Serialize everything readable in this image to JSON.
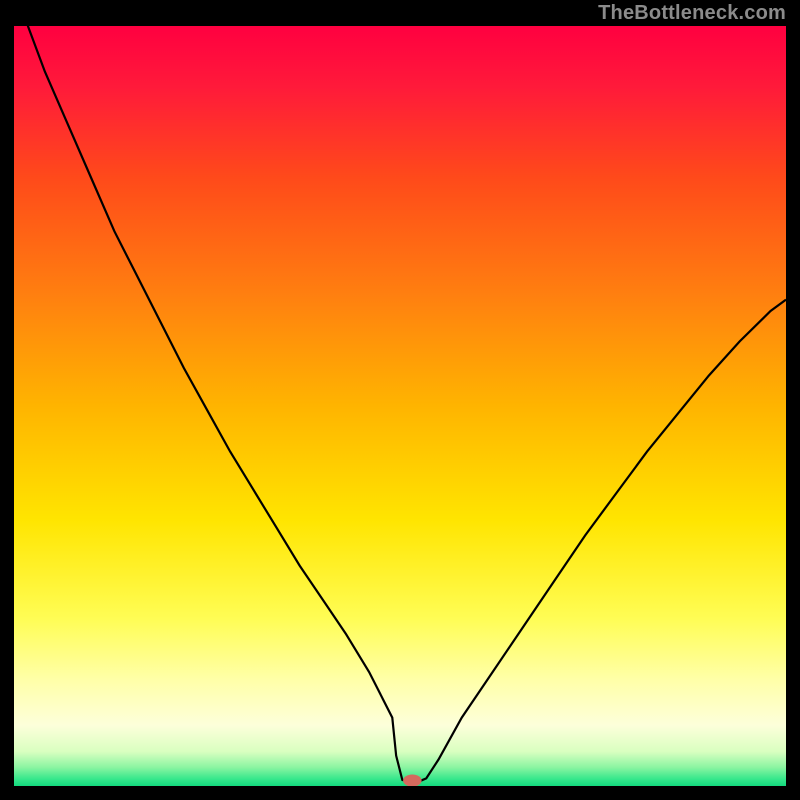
{
  "watermark": "TheBottleneck.com",
  "chart_data": {
    "type": "line",
    "title": "",
    "xlabel": "",
    "ylabel": "",
    "xlim": [
      0,
      100
    ],
    "ylim": [
      0,
      100
    ],
    "gradient_stops": [
      {
        "offset": 0.0,
        "color": "#ff0040"
      },
      {
        "offset": 0.08,
        "color": "#ff1a3a"
      },
      {
        "offset": 0.2,
        "color": "#ff4a1a"
      },
      {
        "offset": 0.35,
        "color": "#ff7e10"
      },
      {
        "offset": 0.5,
        "color": "#ffb400"
      },
      {
        "offset": 0.65,
        "color": "#ffe500"
      },
      {
        "offset": 0.78,
        "color": "#fffd55"
      },
      {
        "offset": 0.86,
        "color": "#ffffa8"
      },
      {
        "offset": 0.92,
        "color": "#fdffda"
      },
      {
        "offset": 0.955,
        "color": "#d9ffc0"
      },
      {
        "offset": 0.975,
        "color": "#8df5a2"
      },
      {
        "offset": 0.99,
        "color": "#3ae88d"
      },
      {
        "offset": 1.0,
        "color": "#14d97e"
      }
    ],
    "series": [
      {
        "name": "bottleneck-curve",
        "x": [
          0,
          1.8,
          4,
          7,
          10,
          13,
          16,
          19,
          22,
          25,
          28,
          31,
          34,
          37,
          40,
          43,
          46,
          49,
          49.5,
          50.3,
          51.2,
          52.0,
          52.7,
          53.4,
          55,
          58,
          62,
          66,
          70,
          74,
          78,
          82,
          86,
          90,
          94,
          98,
          100
        ],
        "values": [
          110,
          100,
          94,
          87,
          80,
          73,
          67,
          61,
          55,
          49.5,
          44,
          39,
          34,
          29,
          24.5,
          20,
          15,
          9,
          4,
          0.8,
          0.5,
          0.5,
          0.7,
          1.0,
          3.5,
          9,
          15,
          21,
          27,
          33,
          38.5,
          44,
          49,
          54,
          58.5,
          62.5,
          64
        ]
      }
    ],
    "marker": {
      "x": 51.6,
      "y": 0.72,
      "rx": 1.2,
      "ry": 0.8,
      "color": "#d46a5e"
    }
  }
}
